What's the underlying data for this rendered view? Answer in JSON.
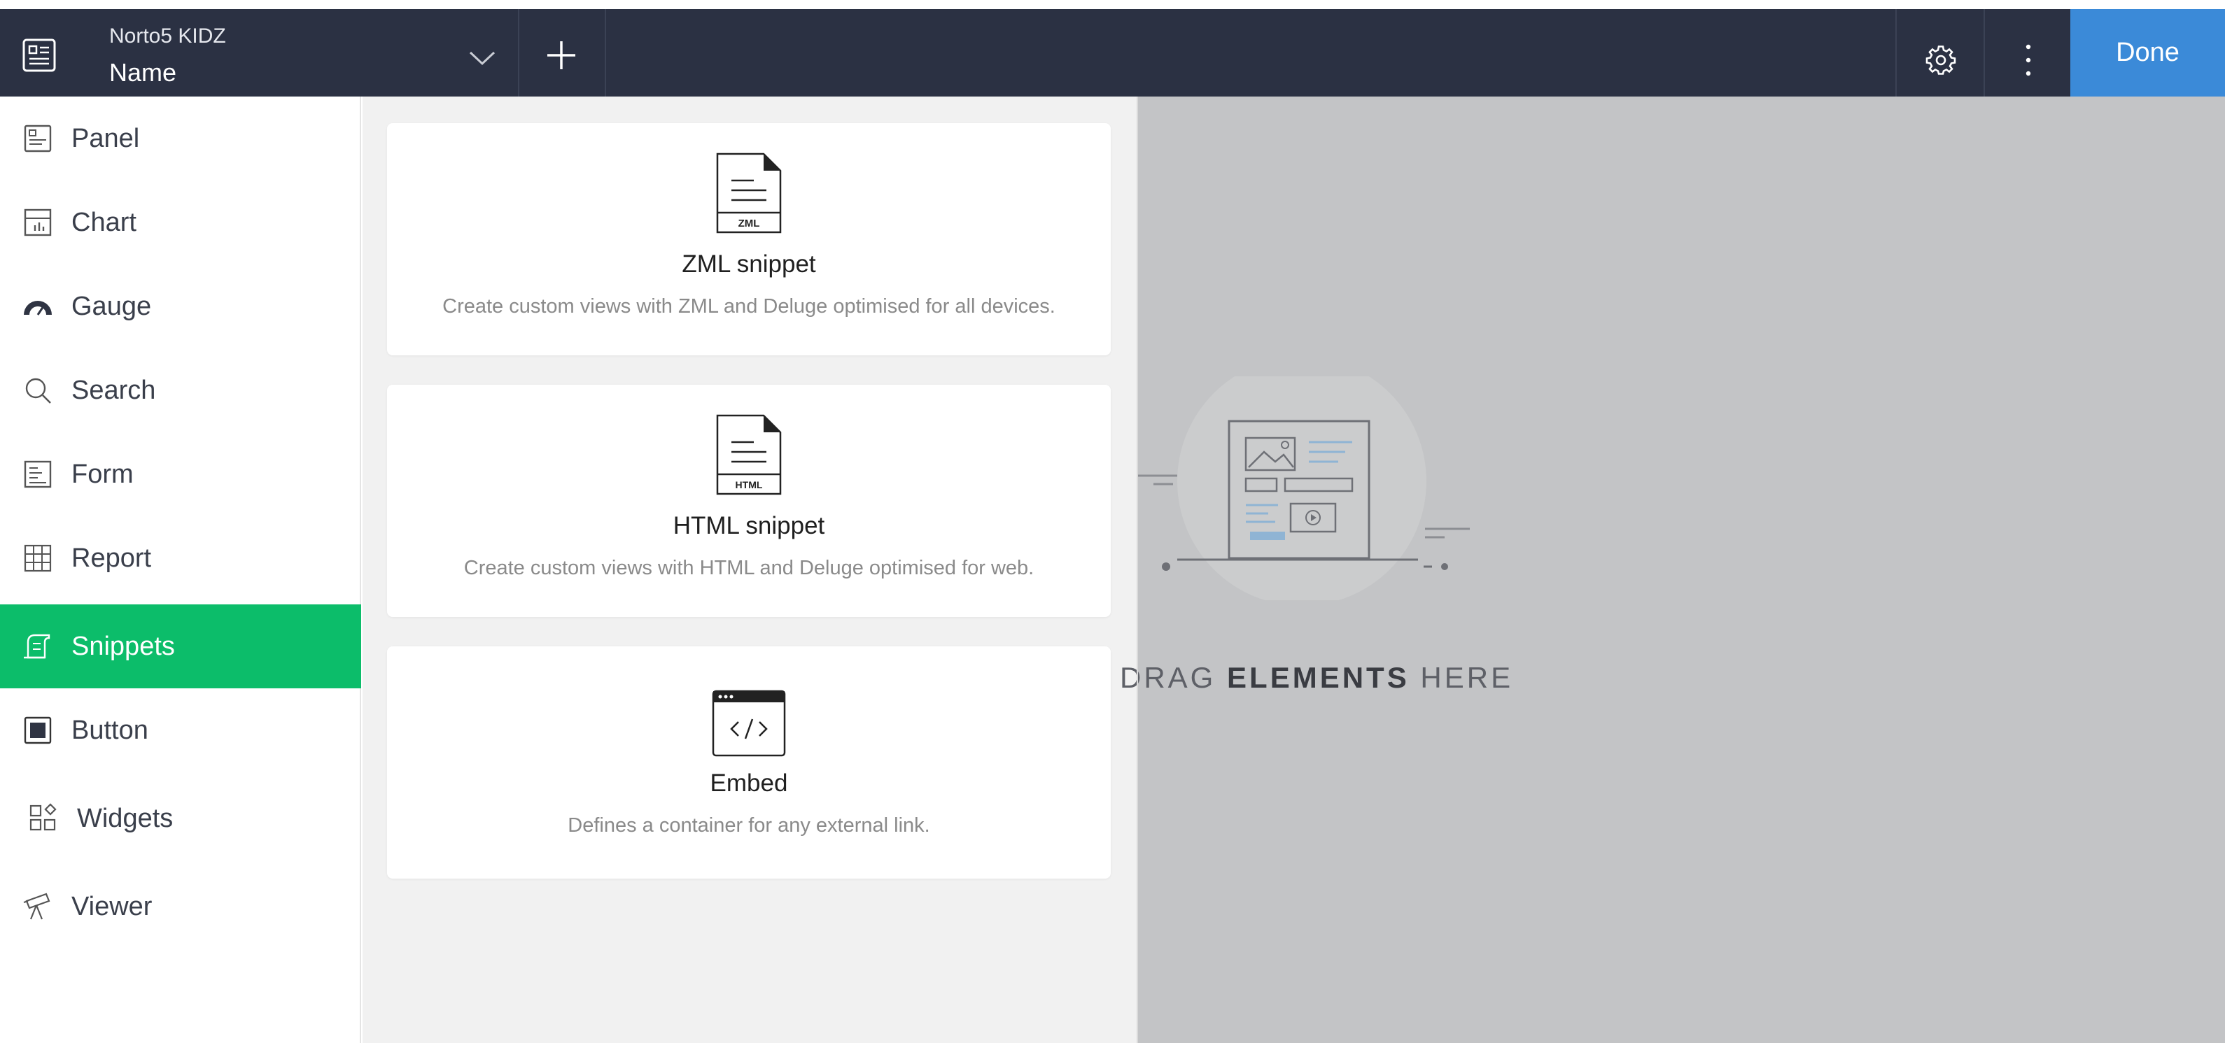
{
  "header": {
    "app_name": "Norto5 KIDZ",
    "page_name": "Name",
    "done_label": "Done"
  },
  "sidebar": {
    "items": [
      {
        "label": "Panel",
        "icon": "panel-icon"
      },
      {
        "label": "Chart",
        "icon": "chart-icon"
      },
      {
        "label": "Gauge",
        "icon": "gauge-icon"
      },
      {
        "label": "Search",
        "icon": "search-icon"
      },
      {
        "label": "Form",
        "icon": "form-icon"
      },
      {
        "label": "Report",
        "icon": "report-icon"
      },
      {
        "label": "Snippets",
        "icon": "snippets-icon",
        "active": true
      },
      {
        "label": "Button",
        "icon": "button-icon"
      },
      {
        "label": "Widgets",
        "icon": "widgets-icon"
      },
      {
        "label": "Viewer",
        "icon": "viewer-icon"
      }
    ]
  },
  "snippets": {
    "cards": [
      {
        "title": "ZML snippet",
        "description": "Create custom views with ZML and Deluge optimised for all devices.",
        "icon_text": "ZML"
      },
      {
        "title": "HTML snippet",
        "description": "Create custom views with HTML and Deluge optimised for web.",
        "icon_text": "HTML"
      },
      {
        "title": "Embed",
        "description": "Defines a container for any external link.",
        "icon_text": ""
      }
    ]
  },
  "canvas": {
    "drag_prefix": "DRAG",
    "drag_bold": "ELEMENTS",
    "drag_suffix": "HERE"
  },
  "colors": {
    "header_bg": "#2b3143",
    "done_bg": "#3b8ad8",
    "active_item_bg": "#0cbd6a",
    "canvas_bg": "#c3c4c6",
    "panel_bg": "#f1f1f1"
  }
}
